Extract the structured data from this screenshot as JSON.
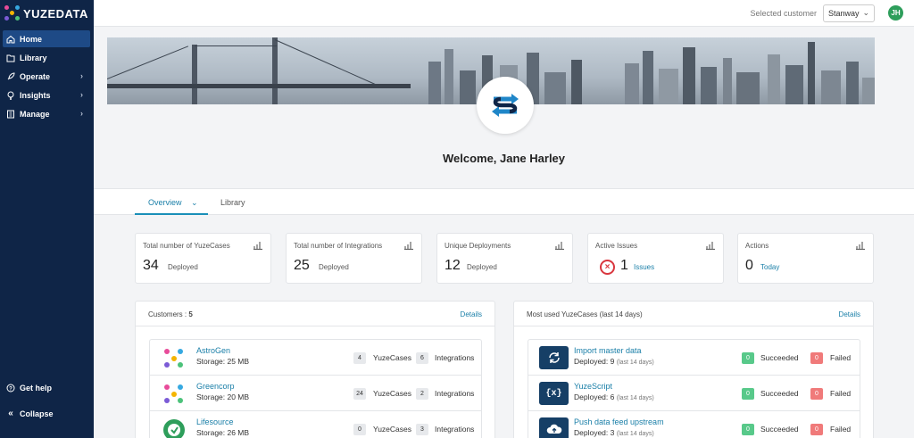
{
  "app": {
    "logo_text": "YUZEDATA"
  },
  "sidebar": {
    "items": [
      {
        "label": "Home",
        "icon": "home-icon"
      },
      {
        "label": "Library",
        "icon": "library-icon"
      },
      {
        "label": "Operate",
        "icon": "rocket-icon"
      },
      {
        "label": "Insights",
        "icon": "lightbulb-icon"
      },
      {
        "label": "Manage",
        "icon": "building-icon"
      }
    ],
    "bottom": [
      {
        "label": "Get help",
        "icon": "help-icon"
      },
      {
        "label": "Collapse",
        "icon": "collapse-icon"
      }
    ]
  },
  "topbar": {
    "customer_label": "Selected customer",
    "customer_value": "Stanway",
    "avatar_initials": "JH"
  },
  "welcome": "Welcome, Jane Harley",
  "tabs": [
    {
      "label": "Overview"
    },
    {
      "label": "Library"
    }
  ],
  "stats": [
    {
      "title": "Total number of YuzeCases",
      "value": "34",
      "sub": "Deployed"
    },
    {
      "title": "Total number of Integrations",
      "value": "25",
      "sub": "Deployed"
    },
    {
      "title": "Unique Deployments",
      "value": "12",
      "sub": "Deployed"
    },
    {
      "title": "Active Issues",
      "value": "1",
      "sub": "Issues"
    },
    {
      "title": "Actions",
      "value": "0",
      "sub": "Today"
    }
  ],
  "customers_panel": {
    "title": "Customers :",
    "count": "5",
    "details": "Details",
    "yuzecases_label": "YuzeCases",
    "integrations_label": "Integrations",
    "rows": [
      {
        "name": "AstroGen",
        "storage": "Storage: 25 MB",
        "yuzecases": "4",
        "integrations": "6"
      },
      {
        "name": "Greencorp",
        "storage": "Storage: 20 MB",
        "yuzecases": "24",
        "integrations": "2"
      },
      {
        "name": "Lifesource",
        "storage": "Storage: 26 MB",
        "yuzecases": "0",
        "integrations": "3"
      }
    ]
  },
  "yuzecases_panel": {
    "title": "Most used YuzeCases (last 14 days)",
    "details": "Details",
    "succeeded_label": "Succeeded",
    "failed_label": "Failed",
    "last_label": "(last 14 days)",
    "rows": [
      {
        "name": "Import master data",
        "deployed": "Deployed: 9",
        "succeeded": "0",
        "failed": "0",
        "icon": "refresh-icon"
      },
      {
        "name": "YuzeScript",
        "deployed": "Deployed: 6",
        "succeeded": "0",
        "failed": "0",
        "icon": "script-icon"
      },
      {
        "name": "Push data feed upstream",
        "deployed": "Deployed: 3",
        "succeeded": "0",
        "failed": "0",
        "icon": "cloud-upload-icon"
      }
    ]
  },
  "colors": {
    "sidebar": "#0f2547",
    "accent": "#1a7fa8",
    "success": "#58c98a",
    "danger": "#f07a7a"
  }
}
